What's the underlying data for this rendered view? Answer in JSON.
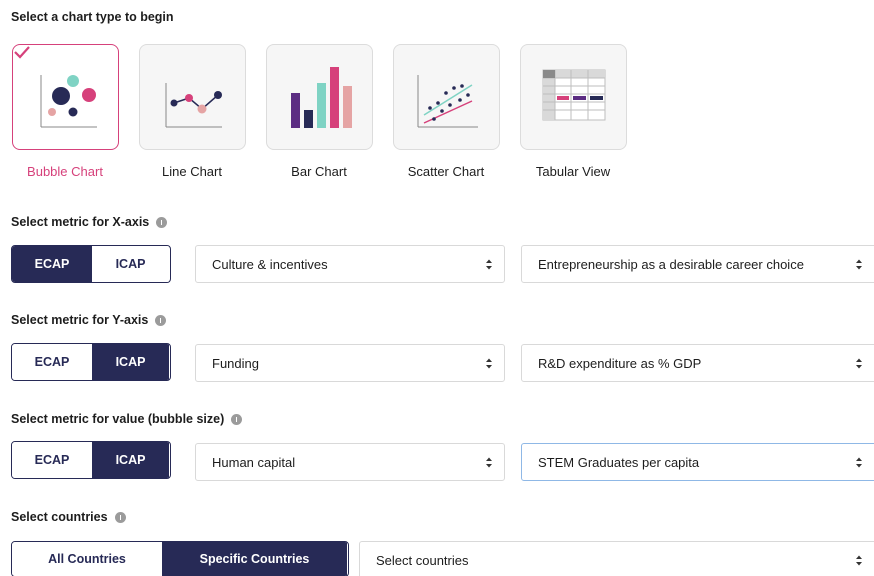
{
  "chart_select": {
    "heading": "Select a chart type to begin",
    "types": [
      {
        "label": "Bubble Chart",
        "selected": true,
        "icon": "bubble-chart-icon"
      },
      {
        "label": "Line Chart",
        "selected": false,
        "icon": "line-chart-icon"
      },
      {
        "label": "Bar Chart",
        "selected": false,
        "icon": "bar-chart-icon"
      },
      {
        "label": "Scatter Chart",
        "selected": false,
        "icon": "scatter-chart-icon"
      },
      {
        "label": "Tabular View",
        "selected": false,
        "icon": "table-icon"
      }
    ]
  },
  "x_axis": {
    "heading": "Select metric for X-axis",
    "toggle": {
      "left": "ECAP",
      "right": "ICAP",
      "active": "ECAP"
    },
    "category": "Culture & incentives",
    "metric": "Entrepreneurship as a desirable career choice"
  },
  "y_axis": {
    "heading": "Select metric for Y-axis",
    "toggle": {
      "left": "ECAP",
      "right": "ICAP",
      "active": "ICAP"
    },
    "category": "Funding",
    "metric": "R&D expenditure as % GDP"
  },
  "value": {
    "heading": "Select metric for value (bubble size)",
    "toggle": {
      "left": "ECAP",
      "right": "ICAP",
      "active": "ICAP"
    },
    "category": "Human capital",
    "metric": "STEM Graduates per capita"
  },
  "countries": {
    "heading": "Select countries",
    "toggle": {
      "left": "All Countries",
      "right": "Specific Countries",
      "active": "Specific Countries"
    },
    "placeholder": "Select countries"
  },
  "colors": {
    "accent_pink": "#d6417b",
    "navy": "#272a56",
    "teal": "#7fd3c4",
    "purple": "#5c2d83",
    "light_pink": "#e5a4a4"
  }
}
